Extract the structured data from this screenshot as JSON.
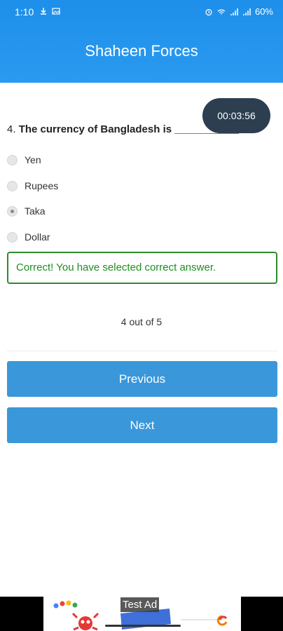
{
  "status_bar": {
    "time": "1:10",
    "battery": "60%",
    "icons": [
      "download-icon",
      "image-icon",
      "alarm-icon",
      "wifi-icon",
      "signal-icon",
      "signal-icon"
    ]
  },
  "header": {
    "title": "Shaheen Forces"
  },
  "timer": {
    "value": "00:03:56"
  },
  "question": {
    "number": "4.",
    "text": "The currency of Bangladesh is ___________?"
  },
  "options": [
    {
      "label": "Yen",
      "selected": false
    },
    {
      "label": "Rupees",
      "selected": false
    },
    {
      "label": "Taka",
      "selected": true
    },
    {
      "label": "Dollar",
      "selected": false
    }
  ],
  "feedback": {
    "message": "Correct! You have selected correct answer.",
    "color": "#2e8b2e"
  },
  "progress": {
    "text": "4 out of 5"
  },
  "buttons": {
    "previous_label": "Previous",
    "next_label": "Next",
    "color": "#3a97d9"
  },
  "ad": {
    "label": "Test Ad"
  },
  "colors": {
    "header": "#1e8fea",
    "timer_bg": "#2c3e50"
  }
}
